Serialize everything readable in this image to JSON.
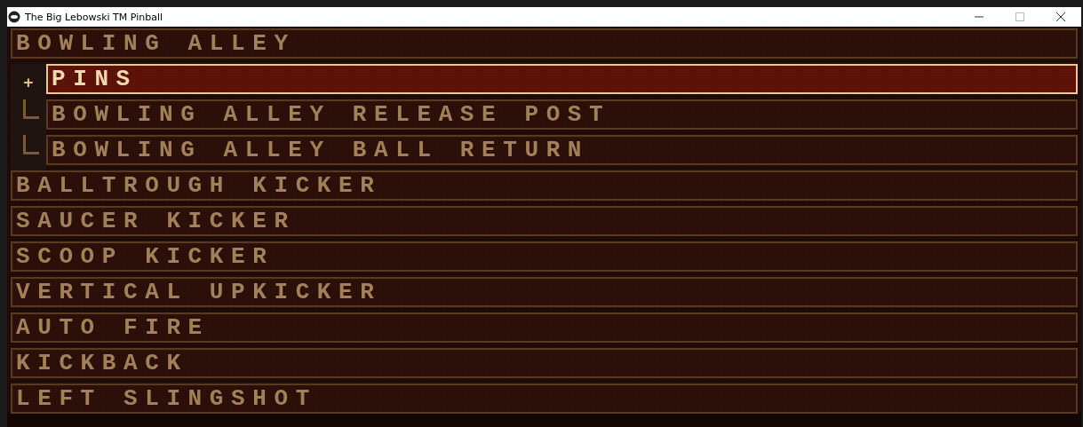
{
  "window": {
    "title": "The Big Lebowski TM Pinball"
  },
  "menu": [
    {
      "label": "BOWLING ALLEY",
      "selected": false,
      "children": [
        {
          "label": "PINS",
          "selected": true,
          "marker": "+"
        },
        {
          "label": "BOWLING ALLEY RELEASE POST",
          "selected": false
        },
        {
          "label": "BOWLING ALLEY BALL RETURN",
          "selected": false
        }
      ]
    },
    {
      "label": "BALLTROUGH KICKER",
      "selected": false
    },
    {
      "label": "SAUCER KICKER",
      "selected": false
    },
    {
      "label": "SCOOP KICKER",
      "selected": false
    },
    {
      "label": "VERTICAL UPKICKER",
      "selected": false
    },
    {
      "label": "AUTO FIRE",
      "selected": false
    },
    {
      "label": "KICKBACK",
      "selected": false
    },
    {
      "label": "LEFT SLINGSHOT",
      "selected": false
    }
  ]
}
